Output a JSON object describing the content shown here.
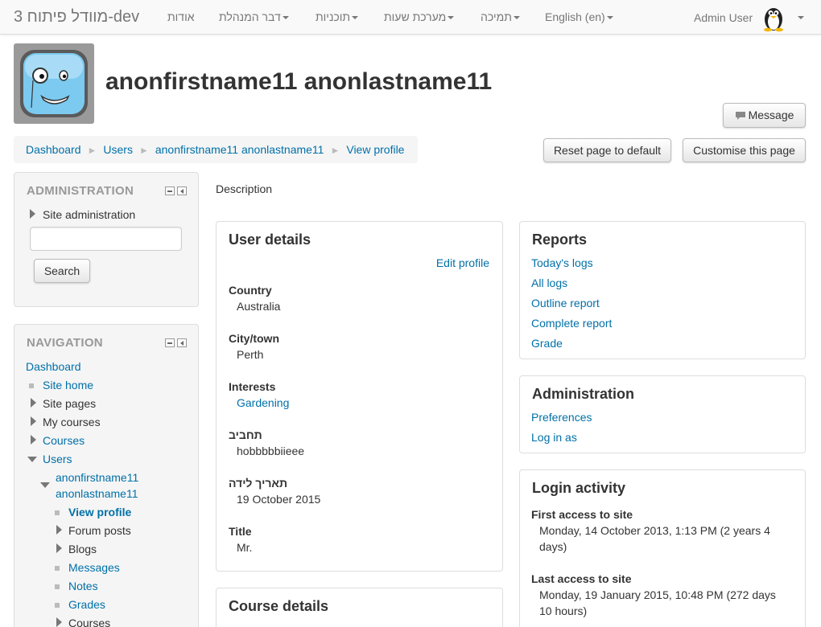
{
  "navbar": {
    "brand": "מוודל פיתוח 3-dev",
    "menus": [
      "אודות",
      "דבר המנהלת",
      "תוכניות",
      "מערכת שעות",
      "תמיכה",
      "English (en)"
    ],
    "user_name": "Admin User"
  },
  "header": {
    "full_name": "anonfirstname11 anonlastname11",
    "message_button": "Message",
    "reset_button": "Reset page to default",
    "customise_button": "Customise this page"
  },
  "breadcrumb": [
    "Dashboard",
    "Users",
    "anonfirstname11 anonlastname11",
    "View profile"
  ],
  "administration_block": {
    "title": "ADMINISTRATION",
    "site_admin": "Site administration",
    "search_value": "",
    "search_button": "Search"
  },
  "navigation_block": {
    "title": "NAVIGATION",
    "dashboard": "Dashboard",
    "items": [
      {
        "label": "Site home",
        "icon": "square",
        "link": true
      },
      {
        "label": "Site pages",
        "icon": "arrow-right",
        "link": false
      },
      {
        "label": "My courses",
        "icon": "arrow-right",
        "link": false
      },
      {
        "label": "Courses",
        "icon": "arrow-right",
        "link": true
      },
      {
        "label": "Users",
        "icon": "arrow-down",
        "link": true
      }
    ],
    "user_node": "anonfirstname11 anonlastname11",
    "user_node_line1": "anonfirstname11",
    "user_node_line2": "anonlastname11",
    "sub_items": [
      {
        "label": "View profile",
        "icon": "square",
        "link": true,
        "active": true
      },
      {
        "label": "Forum posts",
        "icon": "arrow-right",
        "link": false
      },
      {
        "label": "Blogs",
        "icon": "arrow-right",
        "link": false
      },
      {
        "label": "Messages",
        "icon": "square",
        "link": true
      },
      {
        "label": "Notes",
        "icon": "square",
        "link": true
      },
      {
        "label": "Grades",
        "icon": "square",
        "link": true
      },
      {
        "label": "Courses",
        "icon": "arrow-right",
        "link": false
      }
    ]
  },
  "main": {
    "description_label": "Description",
    "user_details": {
      "title": "User details",
      "edit_link": "Edit profile",
      "fields": [
        {
          "label": "Country",
          "value": "Australia",
          "link": false
        },
        {
          "label": "City/town",
          "value": "Perth",
          "link": false
        },
        {
          "label": "Interests",
          "value": "Gardening",
          "link": true
        },
        {
          "label": "תחביב",
          "value": "hobbbbbiieee",
          "link": false
        },
        {
          "label": "תאריך לידה",
          "value": "19 October 2015",
          "link": false
        },
        {
          "label": "Title",
          "value": "Mr.",
          "link": false
        }
      ]
    },
    "course_details": {
      "title": "Course details"
    },
    "reports": {
      "title": "Reports",
      "links": [
        "Today's logs",
        "All logs",
        "Outline report",
        "Complete report",
        "Grade"
      ]
    },
    "administration": {
      "title": "Administration",
      "links": [
        "Preferences",
        "Log in as"
      ]
    },
    "login_activity": {
      "title": "Login activity",
      "first_label": "First access to site",
      "first_line1": "Monday, 14 October 2013, 1:13 PM  (2 years 4",
      "first_line2": "days)",
      "last_label": "Last access to site",
      "last_line1": "Monday, 19 January 2015, 10:48 PM  (272 days",
      "last_line2": "10 hours)"
    }
  },
  "colors": {
    "link": "#0070a8",
    "block_bg": "#f5f5f5",
    "navbar_bg": "#f9f9f9"
  }
}
